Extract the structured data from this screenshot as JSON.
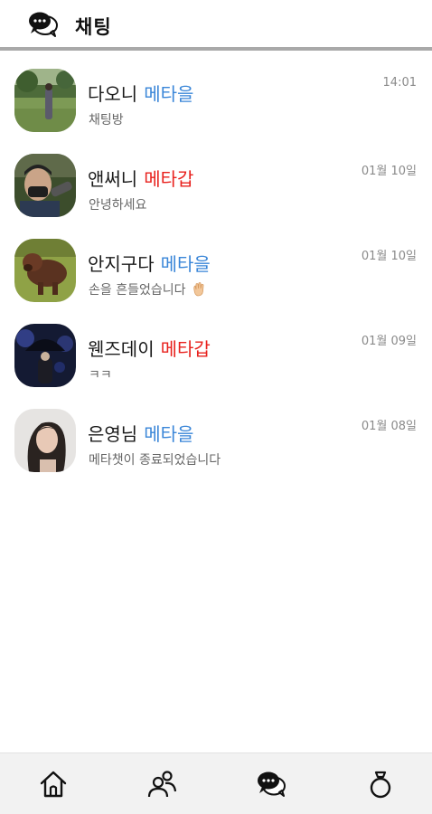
{
  "header": {
    "title": "채팅",
    "icon": "chat-bubbles-icon"
  },
  "chats": [
    {
      "name": "다오니",
      "tag": "메타을",
      "tag_color": "#3a86d8",
      "preview": "채팅방",
      "time": "14:01",
      "avatar": "golf-course-photo"
    },
    {
      "name": "앤써니",
      "tag": "메타갑",
      "tag_color": "#e8211d",
      "preview": "안녕하세요",
      "time": "01월 10일",
      "avatar": "masked-man-photo"
    },
    {
      "name": "안지구다",
      "tag": "메타을",
      "tag_color": "#3a86d8",
      "preview": "손을 흔들었습니다",
      "time": "01월 10일",
      "avatar": "dog-on-grass-photo",
      "preview_icon": "waving-hand-icon"
    },
    {
      "name": "웬즈데이",
      "tag": "메타갑",
      "tag_color": "#e8211d",
      "preview": "ㅋㅋ",
      "time": "01월 09일",
      "avatar": "umbrella-night-photo"
    },
    {
      "name": "은영님",
      "tag": "메타을",
      "tag_color": "#3a86d8",
      "preview": "메타챗이 종료되었습니다",
      "time": "01월 08일",
      "avatar": "woman-portrait-photo"
    }
  ],
  "bottom_nav": {
    "items": [
      {
        "icon": "home-icon",
        "active": false
      },
      {
        "icon": "people-icon",
        "active": false
      },
      {
        "icon": "chat-bubbles-icon",
        "active": true
      },
      {
        "icon": "ring-icon",
        "active": false
      }
    ]
  }
}
